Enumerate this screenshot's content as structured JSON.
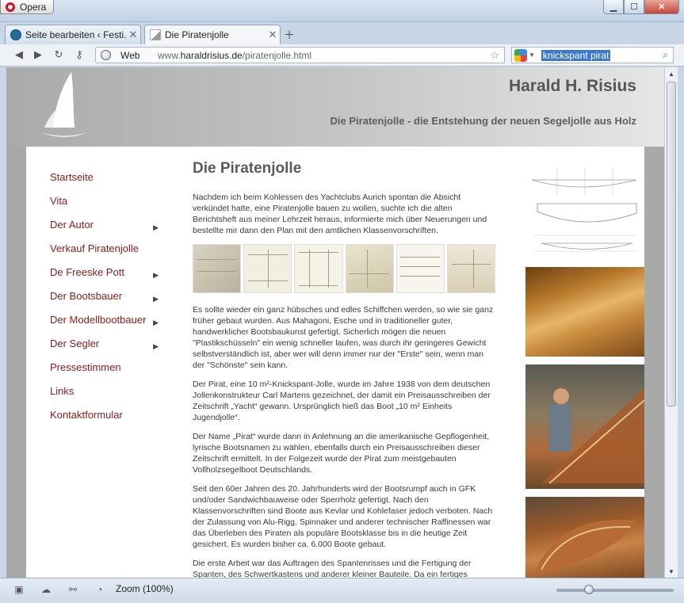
{
  "browser": {
    "menu_label": "Opera",
    "window_controls": {
      "minimize": "▁",
      "maximize": "☐",
      "close": "✕"
    },
    "tabs": [
      {
        "label": "Seite bearbeiten ‹ Festi...",
        "icon": "wordpress-icon",
        "active": false
      },
      {
        "label": "Die Piratenjolle",
        "icon": "sail-favicon",
        "active": true
      }
    ],
    "web_label": "Web",
    "url": {
      "prefix": "www.",
      "domain": "haraldrisius.de",
      "path": "/piratenjolle.html"
    },
    "search": {
      "engine": "google-icon",
      "query": "knickspant pirat"
    },
    "status": {
      "zoom_label": "Zoom (100%)",
      "zoom_fraction": 0.28
    }
  },
  "site": {
    "title": "Harald H. Risius",
    "subtitle": "Die Piratenjolle - die Entstehung der neuen Segeljolle aus Holz",
    "nav": [
      {
        "label": "Startseite",
        "submenu": false
      },
      {
        "label": "Vita",
        "submenu": false
      },
      {
        "label": "Der Autor",
        "submenu": true
      },
      {
        "label": "Verkauf Piratenjolle",
        "submenu": false
      },
      {
        "label": "De Freeske Pott",
        "submenu": true
      },
      {
        "label": "Der Bootsbauer",
        "submenu": true
      },
      {
        "label": "Der Modellbootbauer",
        "submenu": true
      },
      {
        "label": "Der Segler",
        "submenu": true
      },
      {
        "label": "Pressestimmen",
        "submenu": false
      },
      {
        "label": "Links",
        "submenu": false
      },
      {
        "label": "Kontaktformular",
        "submenu": false
      }
    ],
    "submenu_arrow": "▶",
    "article": {
      "heading": "Die Piratenjolle",
      "paragraphs": [
        "Nachdem ich beim Kohlessen des Yachtclubs Aurich spontan die Absicht verkündet hatte, eine Piratenjolle bauen zu wollen, suchte ich die alten Berichtsheft aus meiner Lehrzeit heraus, informierte mich über Neuerungen und bestellte mir dann den Plan mit den amtlichen Klassenvorschriften.",
        "Es sollte wieder ein ganz hübsches und edles Schiffchen werden, so wie sie ganz früher gebaut wurden. Aus Mahagoni, Esche und in traditioneller guter, handwerklicher Bootsbaukunst gefertigt. Sicherlich mögen die neuen \"Plastikschüsseln\" ein wenig schneller laufen, was durch ihr geringeres Gewicht selbstverständlich ist, aber wer will denn immer nur der \"Erste\" sein, wenn man der \"Schönste\" sein kann.",
        "Der Pirat, eine 10 m²-Knickspant-Jolle, wurde im Jahre 1938 von dem deutschen Jollenkonstrukteur Carl Martens gezeichnet, der damit ein Preisausschreiben der Zeitschrift „Yacht“ gewann. Ursprünglich hieß das Boot „10 m² Einheits Jugendjolle“.",
        "Der Name „Pirat“ wurde dann in Anlehnung an die amerikanische Gepflogenheit, lyrische Bootsnamen zu wählen, ebenfalls durch ein Preisausschreiben dieser Zeitschrift ermittelt. In der Folgezeit wurde der Pirat zum meistgebauten Vollholzsegelboot Deutschlands.",
        "Seit den 60er Jahren des 20. Jahrhunderts wird der Bootsrumpf auch in GFK und/oder Sandwichbauweise oder Sperrholz gefertigt. Nach den Klassenvorschriften sind Boote aus Kevlar und Kohlefaser jedoch verboten. Nach der Zulassung von Alu-Rigg, Spinnaker und anderer technischer Raffinessen war das Überleben des Piraten als populäre Bootsklasse bis in die heutige Zeit gesichert. Es wurden bisher ca. 6.000 Boote gebaut.",
        "Die erste Arbeit war das Auftragen des Spantenrisses und die Fertigung der Spanten, des Schwertkastens und anderer kleiner Bauteile. Da ein fertiges"
      ]
    }
  }
}
